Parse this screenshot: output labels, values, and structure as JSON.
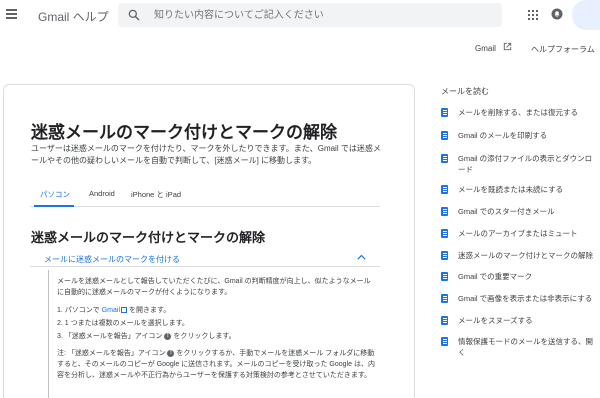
{
  "header": {
    "brand": "Gmail ヘルプ",
    "search_placeholder": "知りたい内容についてご記入ください"
  },
  "subnav": {
    "gmail_label": "Gmail",
    "forum_label": "ヘルプフォーラム"
  },
  "article": {
    "title": "迷惑メールのマーク付けとマークの解除",
    "intro": "ユーザーは迷惑メールのマークを付けたり、マークを外したりできます。また、Gmail では迷惑メールやその他の疑わしいメールを自動で判断して、[迷惑メール] に移動します。",
    "tabs": [
      "パソコン",
      "Android",
      "iPhone と iPad"
    ],
    "section_title": "迷惑メールのマーク付けとマークの解除",
    "accordion": {
      "title": "メールに迷惑メールのマークを付ける",
      "paragraph": "メールを迷惑メールとして報告していただくたびに、Gmail の判断精度が向上し、似たようなメールに自動的に迷惑メールのマークが付くようになります。",
      "step1_prefix": "1. パソコンで ",
      "step1_link": "Gmail",
      "step1_suffix": " を開きます。",
      "step2": "2. 1 つまたは複数のメールを選択します。",
      "step3_prefix": "3. 「迷惑メールを報告」アイコン ",
      "step3_suffix": " をクリックします。",
      "note_prefix": "注: 「迷惑メールを報告」アイコン ",
      "note_suffix": " をクリックするか、手動でメールを迷惑メール フォルダに移動すると、そのメールのコピーが Google に送信されます。メールのコピーを受け取った Google は、内容を分析し、迷惑メールや不正行為からユーザーを保護する対策検討の参考とさせていただきます。"
    }
  },
  "sidebar": {
    "title": "メールを読む",
    "items": [
      "メールを削除する、または復元する",
      "Gmail のメールを印刷する",
      "Gmail の添付ファイルの表示とダウンロード",
      "メールを既読または未読にする",
      "Gmail でのスター付きメール",
      "メールのアーカイブまたはミュート",
      "迷惑メールのマーク付けとマークの解除",
      "Gmail での重要マーク",
      "Gmail で画像を表示または非表示にする",
      "メールをスヌーズする",
      "情報保護モードのメールを送信する、開く"
    ]
  },
  "colors": {
    "accent": "#1a73e8",
    "text": "#202124",
    "muted": "#5f6368",
    "border": "#dadce0"
  },
  "icons": [
    "menu-icon",
    "search-icon",
    "apps-icon",
    "notifications-icon",
    "open-in-new-icon",
    "chevron-up-icon",
    "info-icon",
    "document-icon"
  ]
}
